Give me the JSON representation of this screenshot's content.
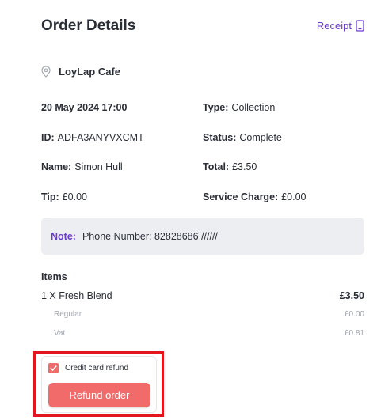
{
  "header": {
    "title": "Order Details",
    "receipt_label": "Receipt"
  },
  "venue": {
    "name": "LoyLap Cafe"
  },
  "details": {
    "date": "20 May 2024 17:00",
    "type_label": "Type:",
    "type_value": "Collection",
    "id_label": "ID:",
    "id_value": "ADFA3ANYVXCMT",
    "status_label": "Status:",
    "status_value": "Complete",
    "name_label": "Name:",
    "name_value": "Simon Hull",
    "total_label": "Total:",
    "total_value": "£3.50",
    "tip_label": "Tip:",
    "tip_value": "£0.00",
    "service_label": "Service Charge:",
    "service_value": "£0.00"
  },
  "note": {
    "label": "Note:",
    "text": "Phone Number: 82828686 //////"
  },
  "items": {
    "title": "Items",
    "list": [
      {
        "name": "1 X Fresh Blend",
        "price": "£3.50",
        "sub": [
          {
            "name": "Regular",
            "price": "£0.00"
          },
          {
            "name": "Vat",
            "price": "£0.81"
          }
        ]
      }
    ]
  },
  "refund": {
    "checkbox_label": "Credit card refund",
    "checked": true,
    "button_label": "Refund order"
  },
  "colors": {
    "accent": "#6b3cc9",
    "refund": "#f26b6b",
    "highlight": "#e3151f"
  }
}
